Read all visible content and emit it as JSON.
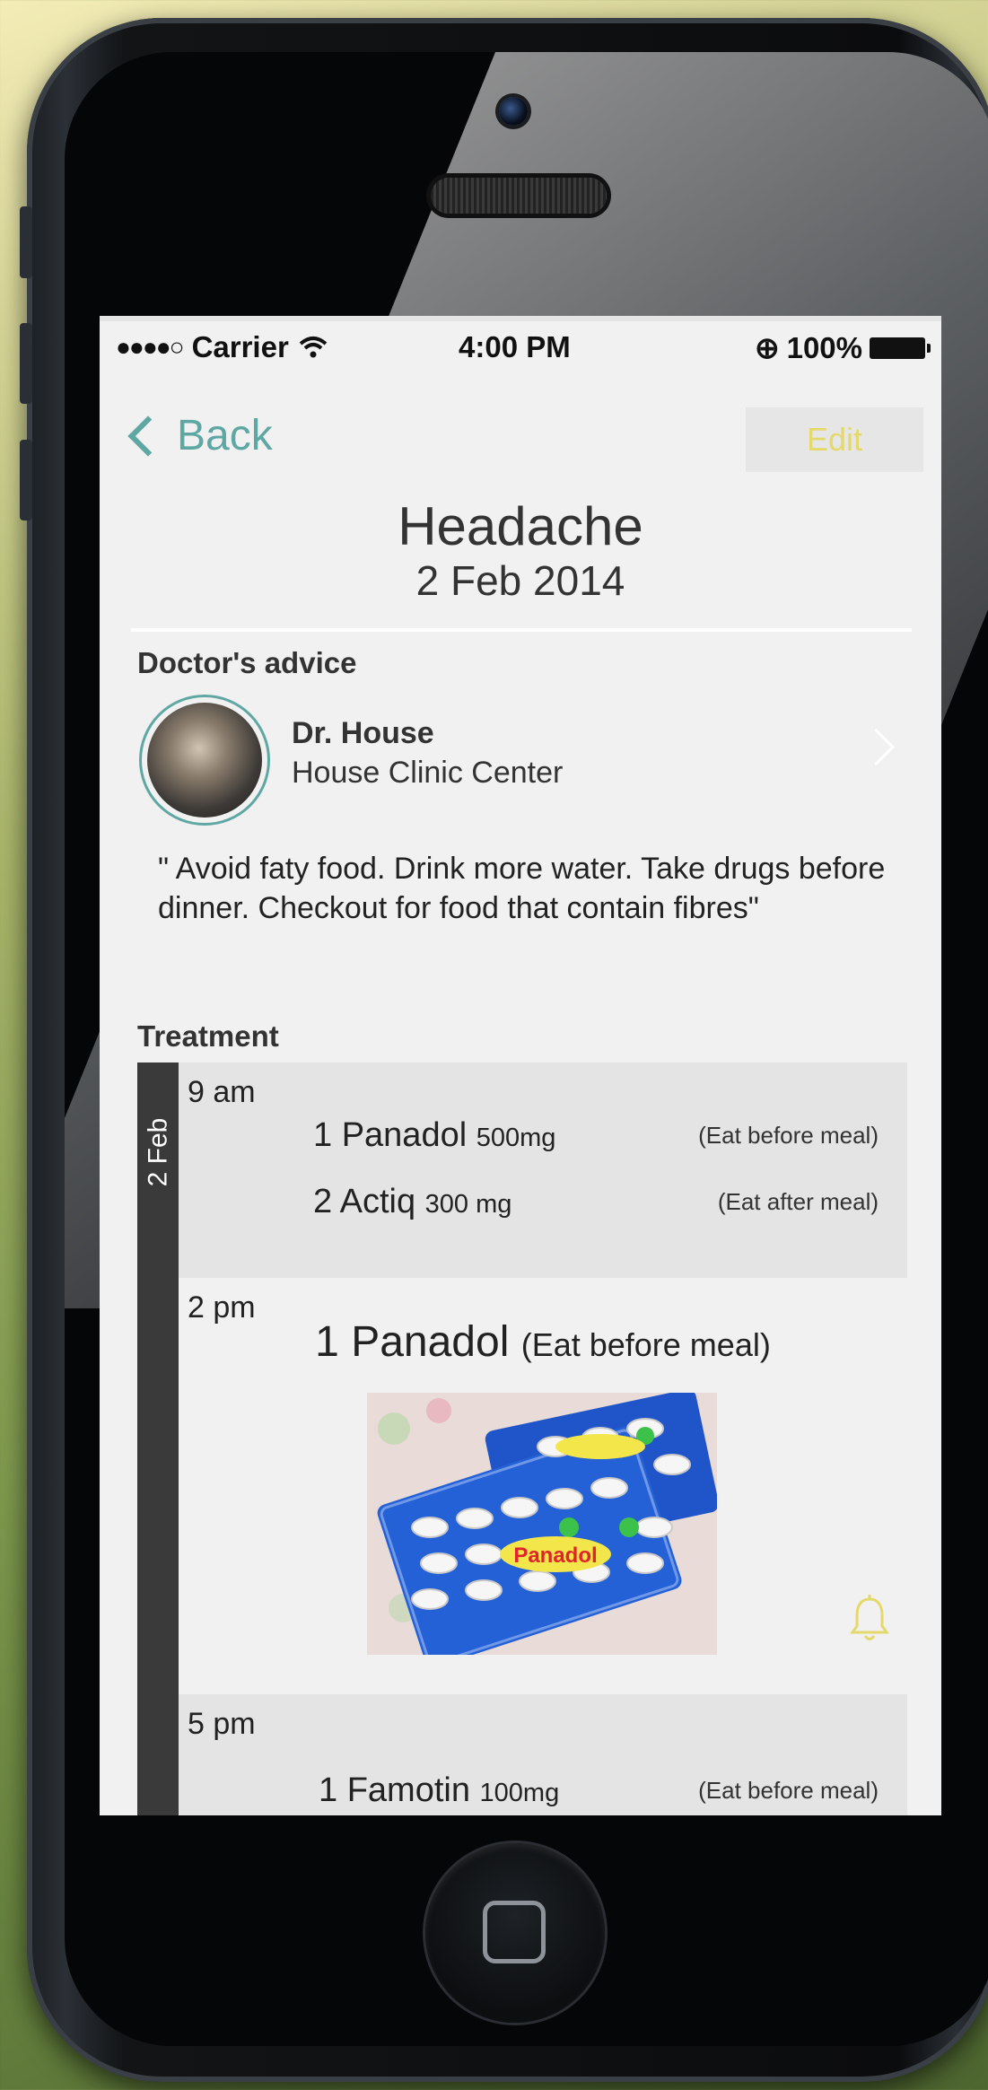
{
  "status_bar": {
    "signal": "●●●●○",
    "carrier": "Carrier",
    "wifi": "wifi-icon",
    "time": "4:00 PM",
    "lock": "⊕",
    "battery": "100%"
  },
  "nav": {
    "back_label": "Back",
    "edit_label": "Edit"
  },
  "condition": {
    "title": "Headache",
    "date": "2 Feb 2014"
  },
  "advice": {
    "section_title": "Doctor's advice",
    "doctor_name": "Dr. House",
    "clinic": "House Clinic Center",
    "text": "\" Avoid faty food. Drink more water. Take drugs before dinner. Checkout for food that contain fibres\""
  },
  "treatment": {
    "section_title": "Treatment",
    "date_label": "2 Feb",
    "slot_9am": {
      "time": "9 am",
      "meds": [
        {
          "name": "1 Panadol",
          "dose": "500mg",
          "note": "(Eat before meal)"
        },
        {
          "name": "2 Actiq",
          "dose": "300 mg",
          "note": "(Eat after meal)"
        }
      ]
    },
    "slot_2pm": {
      "time": "2 pm",
      "name": "1 Panadol",
      "note": "(Eat before meal)",
      "image_label": "Panadol"
    },
    "slot_5pm": {
      "time": "5 pm",
      "meds": [
        {
          "name": "1 Famotin",
          "dose": "100mg",
          "note": "(Eat before meal)"
        }
      ]
    }
  },
  "colors": {
    "accent_teal": "#5fa7a3",
    "accent_yellow": "#e4d96a"
  }
}
